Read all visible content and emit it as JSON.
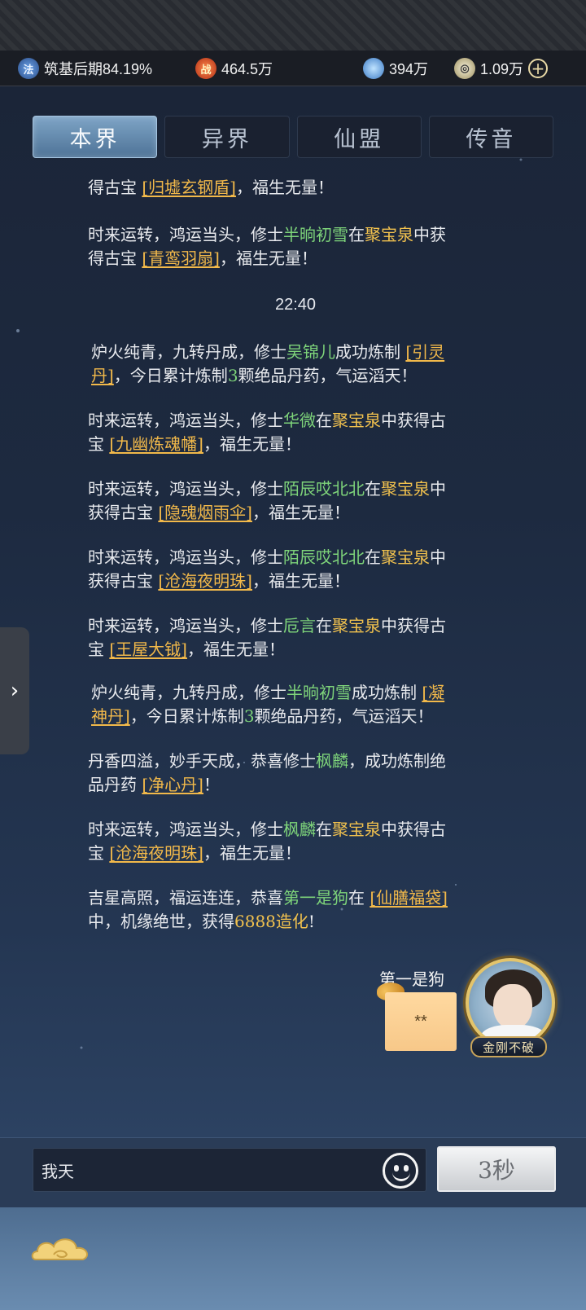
{
  "status": {
    "realm": "筑基后期84.19%",
    "realm_icon": "法",
    "power": "464.5万",
    "power_icon": "战",
    "gems": "394万",
    "coins": "1.09万"
  },
  "tabs": [
    {
      "label": "本界",
      "active": true
    },
    {
      "label": "异界",
      "active": false
    },
    {
      "label": "仙盟",
      "active": false
    },
    {
      "label": "传音",
      "active": false
    }
  ],
  "feed": {
    "m0": {
      "a": "得古宝 ",
      "item": "[归墟玄钢盾]",
      "b": "，福生无量！"
    },
    "m1": {
      "a": "时来运转，鸿运当头，修士",
      "name": "半晌初雪",
      "c": "在",
      "place": "聚宝泉",
      "d": "中获",
      "e": "得古宝 ",
      "item": "[青鸾羽扇]",
      "f": "，福生无量！"
    },
    "time": "22:40",
    "m2": {
      "a": "炉火纯青，九转丹成，修士",
      "name": "吴锦儿",
      "b": "成功炼制 ",
      "item1": "[引灵",
      "item2": "丹]",
      "c": "，今日累计炼制",
      "num": "3",
      "d": "颗绝品丹药，气运滔天！"
    },
    "m3": {
      "a": "时来运转，鸿运当头，修士",
      "name": "华微",
      "b": "在",
      "place": "聚宝泉",
      "c": "中获得古",
      "d": "宝 ",
      "item": "[九幽炼魂幡]",
      "e": "，福生无量！"
    },
    "m4": {
      "a": "时来运转，鸿运当头，修士",
      "name": "陌辰哎北北",
      "b": "在",
      "place": "聚宝泉",
      "c": "中",
      "d": "获得古宝 ",
      "item": "[隐魂烟雨伞]",
      "e": "，福生无量！"
    },
    "m5": {
      "a": "时来运转，鸿运当头，修士",
      "name": "陌辰哎北北",
      "b": "在",
      "place": "聚宝泉",
      "c": "中",
      "d": "获得古宝 ",
      "item": "[沧海夜明珠]",
      "e": "，福生无量！"
    },
    "m6": {
      "a": "时来运转，鸿运当头，修士",
      "name": "卮言",
      "b": "在",
      "place": "聚宝泉",
      "c": "中获得古",
      "d": "宝 ",
      "item": "[王屋大钺]",
      "e": "，福生无量！"
    },
    "m7": {
      "a": "炉火纯青，九转丹成，修士",
      "name": "半晌初雪",
      "b": "成功炼制 ",
      "item1": "[凝",
      "item2": "神丹]",
      "c": "，今日累计炼制",
      "num": "3",
      "d": "颗绝品丹药，气运滔天！"
    },
    "m8": {
      "a": "丹香四溢，妙手天成，恭喜修士",
      "name": "枫麟",
      "b": "，成功炼制绝",
      "c": "品丹药 ",
      "item": "[净心丹]",
      "d": "！"
    },
    "m9": {
      "a": "时来运转，鸿运当头，修士",
      "name": "枫麟",
      "b": "在",
      "place": "聚宝泉",
      "c": "中获得古",
      "d": "宝 ",
      "item": "[沧海夜明珠]",
      "e": "，福生无量！"
    },
    "m10": {
      "a": "吉星高照，福运连连，恭喜",
      "name": "第一是狗",
      "b": "在 ",
      "item": "[仙膳福袋]",
      "c": "中，机缘绝世，获得",
      "reward": "6888造化",
      "d": "!"
    }
  },
  "chat": {
    "sender": "第一是狗",
    "bubble_text": "**",
    "sender_title": "金刚不破"
  },
  "input": {
    "value": "我天",
    "send_label": "3秒"
  },
  "colors": {
    "player_name": "#7ed47a",
    "place": "#f2c24e",
    "item": "#f2b94a",
    "active_tab": "#6a90b4"
  },
  "icons": [
    "realm-icon",
    "power-icon",
    "gem-icon",
    "coin-icon",
    "plus-icon",
    "chevron-right-icon",
    "emoji-icon",
    "cloud-icon"
  ]
}
